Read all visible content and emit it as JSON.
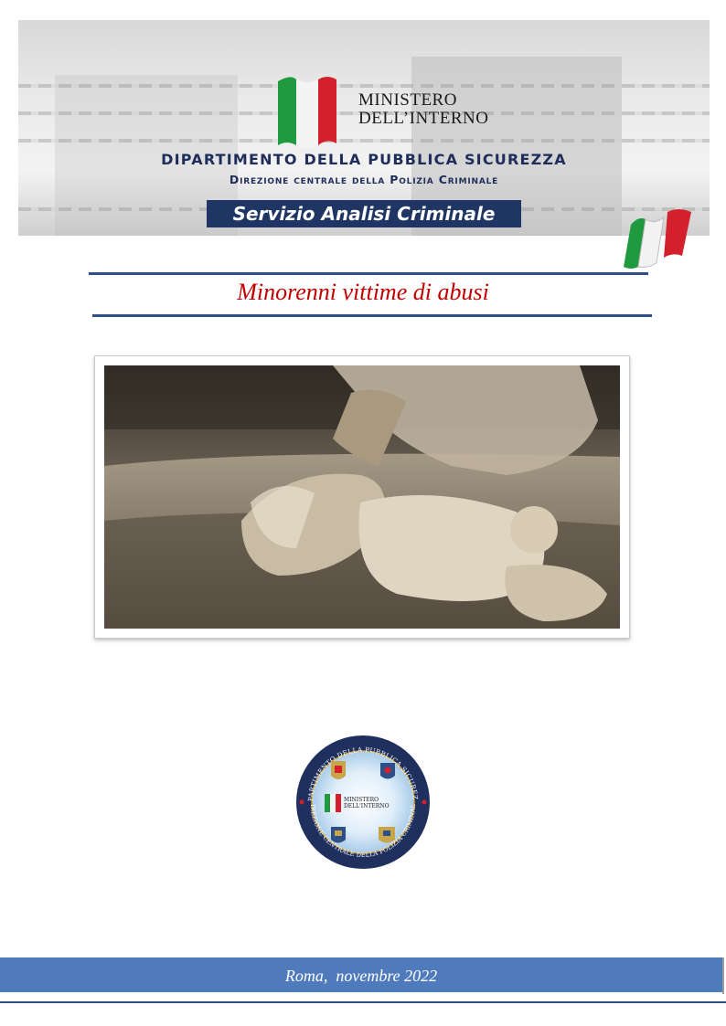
{
  "header": {
    "ministry_line1": "MINISTERO",
    "ministry_line2": "DELL’INTERNO",
    "department": "DIPARTIMENTO DELLA PUBBLICA SICUREZZA",
    "directorate": "Direzione centrale della Polizia Criminale",
    "service": "Servizio Analisi Criminale"
  },
  "document": {
    "title": "Minorenni vittime di abusi"
  },
  "seal": {
    "ring_top": "DIPARTIMENTO DELLA PUBBLICA SICUREZZA",
    "ring_bottom": "DIREZIONE CENTRALE DELLA POLIZIA CRIMINALE",
    "center_line1": "MINISTERO",
    "center_line2": "DELL'INTERNO"
  },
  "footer": {
    "place_date": "Roma,  novembre 2022"
  },
  "colors": {
    "navy": "#1f3563",
    "title_red": "#c00000",
    "footer_blue": "#4f7bbd",
    "flag_green": "#1f9a3f",
    "flag_red": "#d4202c"
  }
}
